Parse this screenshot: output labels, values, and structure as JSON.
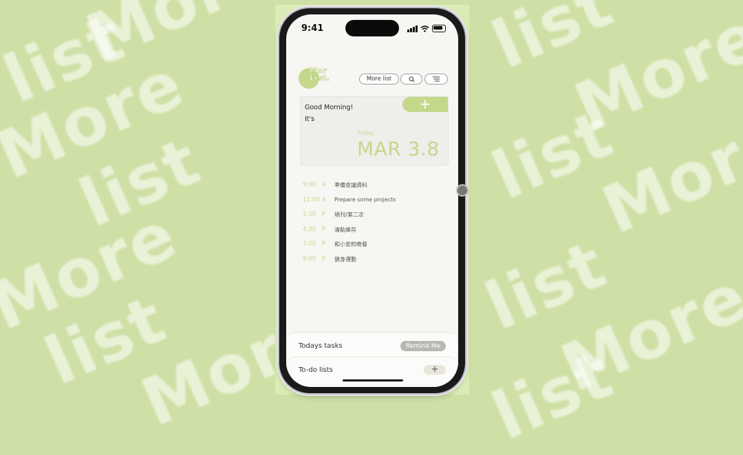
{
  "background": {
    "watermark_words": [
      "More",
      "list",
      "More",
      "list",
      "More",
      "list",
      "More",
      "list",
      "More",
      "list",
      "More",
      "list",
      "More",
      "list"
    ],
    "color": "#cfe0a6"
  },
  "status_bar": {
    "time": "9:41"
  },
  "header": {
    "logo_text_line1": "Mor",
    "logo_text_line2": "List.",
    "more_list_button": "More list",
    "search_icon": "search-icon",
    "menu_icon": "menu-icon"
  },
  "card": {
    "add_label": "+",
    "greeting": "Good Morning!",
    "its": "It's",
    "day": "Friday",
    "date": "MAR 3.8"
  },
  "schedule": [
    {
      "time": "9:00",
      "ampm": "A",
      "task": "準備會議資料"
    },
    {
      "time": "11:00",
      "ampm": "A",
      "task": "Prepare some projects"
    },
    {
      "time": "1:30",
      "ampm": "P",
      "task": "堝刊/第二次"
    },
    {
      "time": "4:30",
      "ampm": "P",
      "task": "清點庫存"
    },
    {
      "time": "7:20",
      "ampm": "P",
      "task": "和小安約晚餐"
    },
    {
      "time": "9:00",
      "ampm": "P",
      "task": "健身運動"
    }
  ],
  "bottom": {
    "todays_tasks": "Todays tasks",
    "remind_me": "Remind Me",
    "todo_lists": "To-do lists",
    "todo_add": "+"
  },
  "colors": {
    "accent": "#c4d88a",
    "screen_bg": "#f7f6f2"
  }
}
